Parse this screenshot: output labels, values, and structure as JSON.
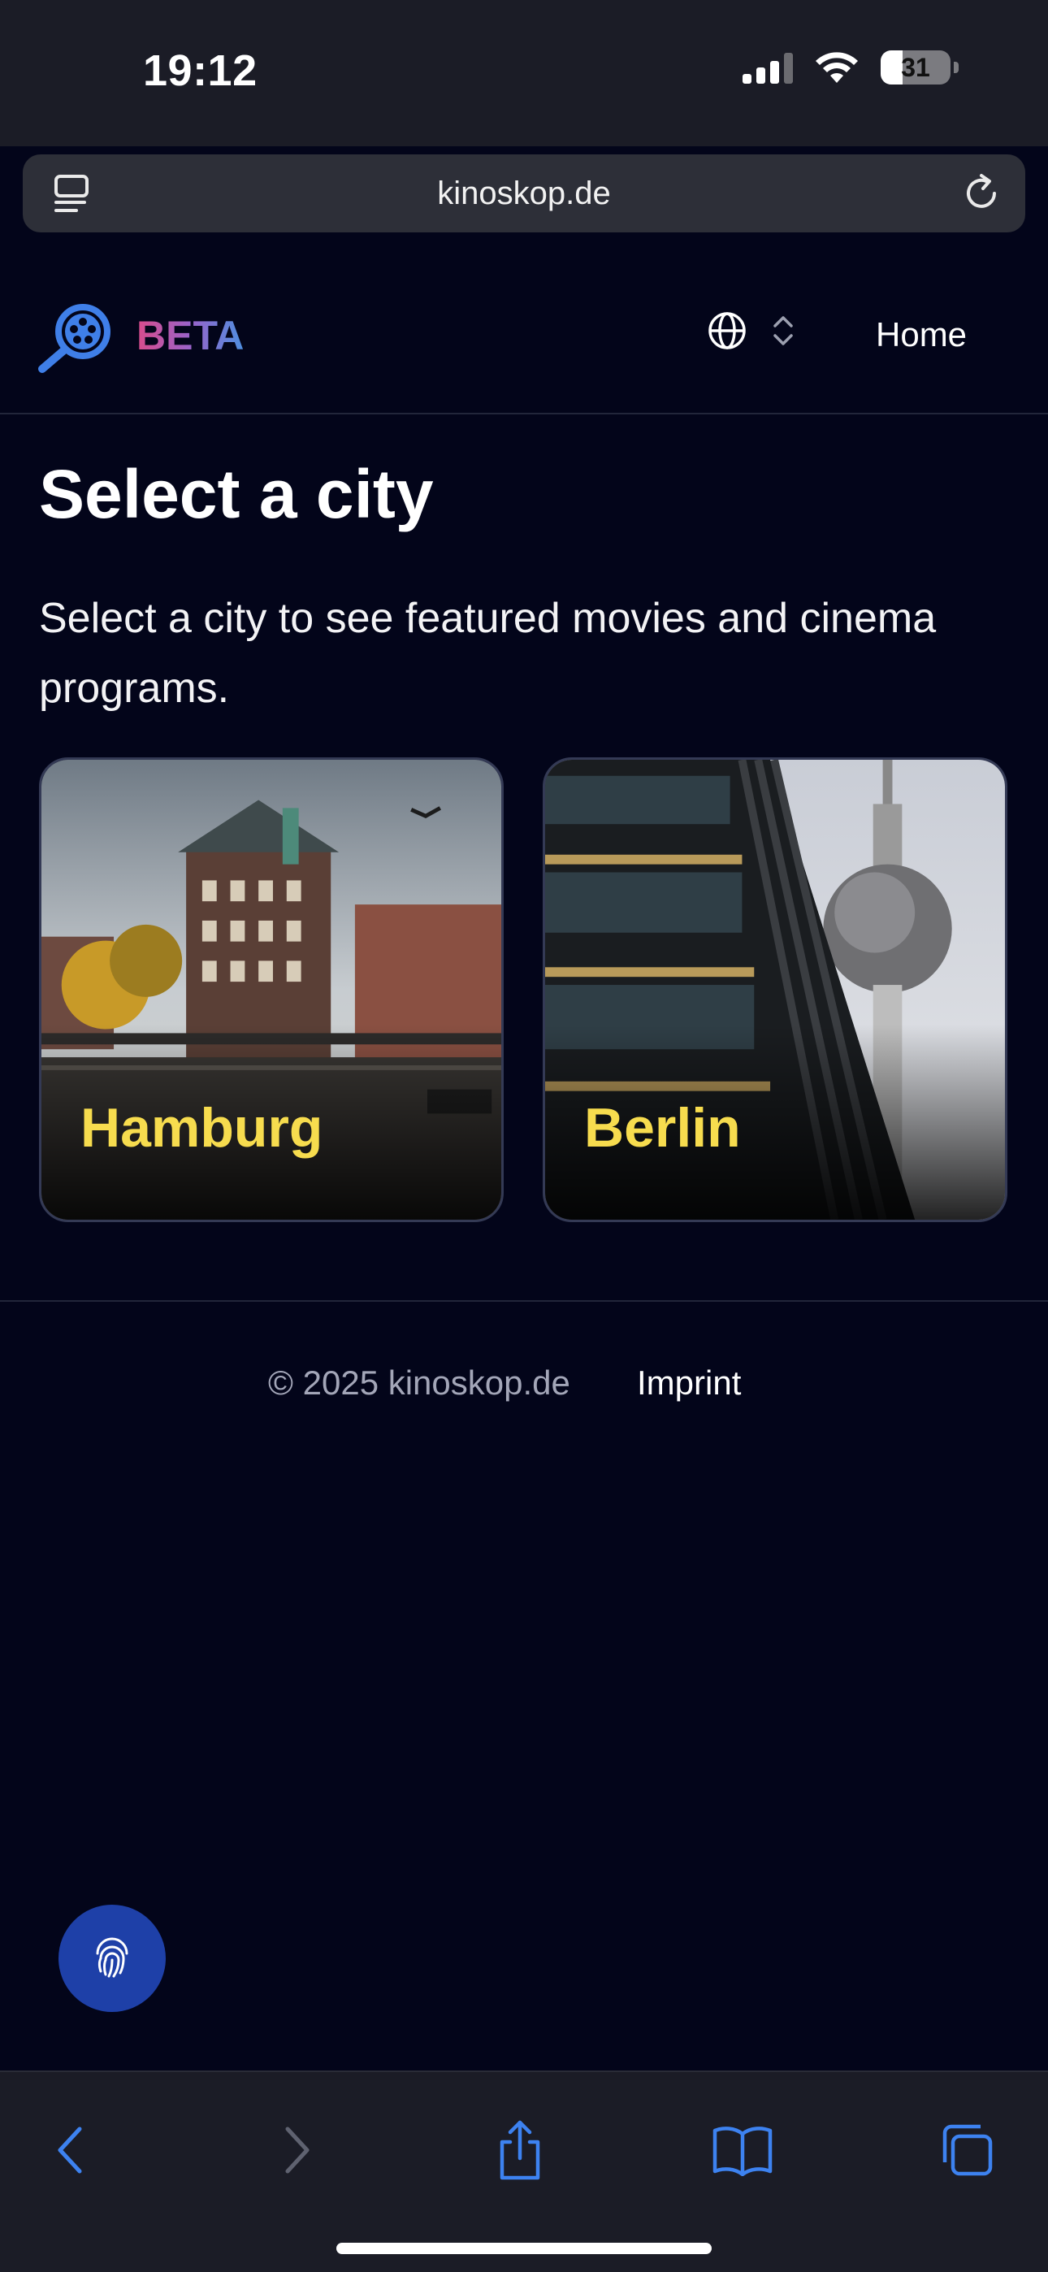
{
  "status_bar": {
    "time": "19:12",
    "battery": "31"
  },
  "browser": {
    "url": "kinoskop.de"
  },
  "header": {
    "logo_text": "BETA",
    "nav_home": "Home"
  },
  "main": {
    "title": "Select a city",
    "description": "Select a city to see featured movies and cinema programs.",
    "cities": [
      {
        "name": "Hamburg"
      },
      {
        "name": "Berlin"
      }
    ]
  },
  "footer": {
    "copyright": "© 2025 kinoskop.de",
    "imprint": "Imprint"
  },
  "colors": {
    "accent_yellow": "#f7dc4e",
    "fab_blue": "#1e40a8",
    "background": "#03051a"
  },
  "icons": [
    "tabs-overview-icon",
    "reload-icon",
    "film-search-logo-icon",
    "globe-icon",
    "chevron-updown-icon",
    "fingerprint-icon",
    "back-icon",
    "forward-icon",
    "share-icon",
    "bookmarks-icon",
    "tabs-icon"
  ]
}
